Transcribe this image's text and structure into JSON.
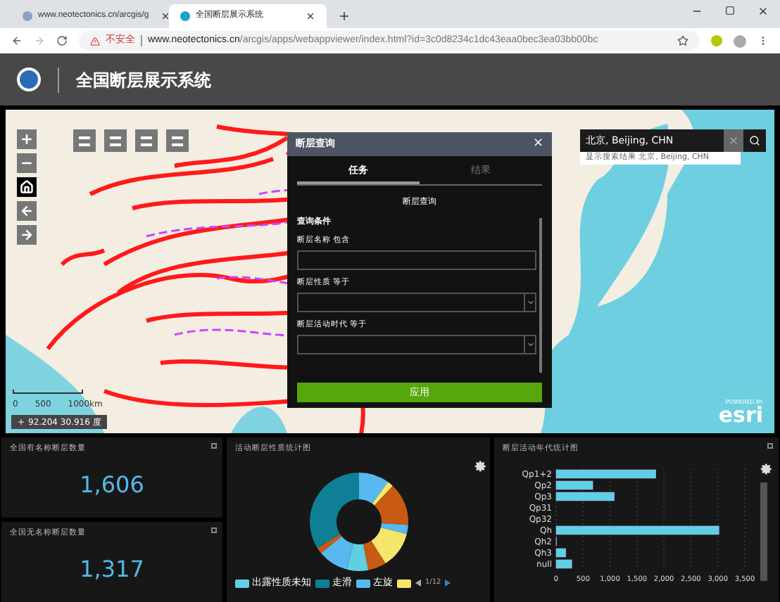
{
  "browser": {
    "tabs": [
      {
        "title": "www.neotectonics.cn/arcgis/g",
        "selected": false
      },
      {
        "title": "全国断层展示系统",
        "selected": true
      }
    ],
    "address": {
      "security": "不安全",
      "host": "www.neotectonics.cn",
      "path": "/arcgis/apps/webappviewer/index.html?id=3c0d8234c1dc43eaa0bec3ea03bb00bc"
    }
  },
  "header": {
    "title": "全国断层展示系统"
  },
  "map": {
    "scale": [
      "0",
      "500",
      "1000km"
    ],
    "coordinates": "92.204 30.916 度",
    "powered": "POWERED BY",
    "logo": "esri"
  },
  "search": {
    "value": "北京, Beijing, CHN",
    "suggestion": "显示搜索结果 北京, Beijing, CHN"
  },
  "dialog": {
    "title": "断层查询",
    "close": "×",
    "tabs": [
      {
        "label": "任务",
        "selected": true
      },
      {
        "label": "结果",
        "selected": false
      }
    ],
    "query_title": "断层查询",
    "section": "查询条件",
    "fields": [
      {
        "kind": "text",
        "label": "断层名称 包含"
      },
      {
        "kind": "select",
        "label": "断层性质 等于"
      },
      {
        "kind": "select",
        "label": "断层活动时代 等于"
      }
    ],
    "apply": "应用"
  },
  "counts": [
    {
      "title": "全国有名称断层数量",
      "value": "1,606"
    },
    {
      "title": "全国无名称断层数量",
      "value": "1,317"
    }
  ],
  "pie_panel": {
    "title": "活动断层性质统计图",
    "legend": [
      {
        "label": "出露性质未知",
        "color": "#5fd0e3"
      },
      {
        "label": "走滑",
        "color": "#0e7f94"
      },
      {
        "label": "左旋",
        "color": "#57b9f0"
      },
      {
        "color": "#f5e66b"
      }
    ],
    "page": "1/12"
  },
  "bar_panel": {
    "title": "断层活动年代统计图",
    "chart_data": {
      "type": "bar",
      "orientation": "horizontal",
      "categories": [
        "Qp1+2",
        "Qp2",
        "Qp3",
        "Qp31",
        "Qp32",
        "Qh",
        "Qh2",
        "Qh3",
        "null"
      ],
      "grid": true,
      "series": [
        {
          "color": "#5fd0e3",
          "values": [
            1850,
            680,
            1080,
            0,
            0,
            3020,
            10,
            180,
            290
          ]
        }
      ],
      "xlim": [
        0,
        3500
      ],
      "xticks": [
        0,
        500,
        {
          "value": 1000,
          "label": "1,000"
        },
        {
          "value": 1500,
          "label": "1,500"
        },
        {
          "value": 2000,
          "label": "2,000"
        },
        {
          "value": 2500,
          "label": "2,500"
        },
        {
          "value": 3000,
          "label": "3,000"
        },
        {
          "value": 3500,
          "label": "3,500"
        }
      ]
    }
  }
}
